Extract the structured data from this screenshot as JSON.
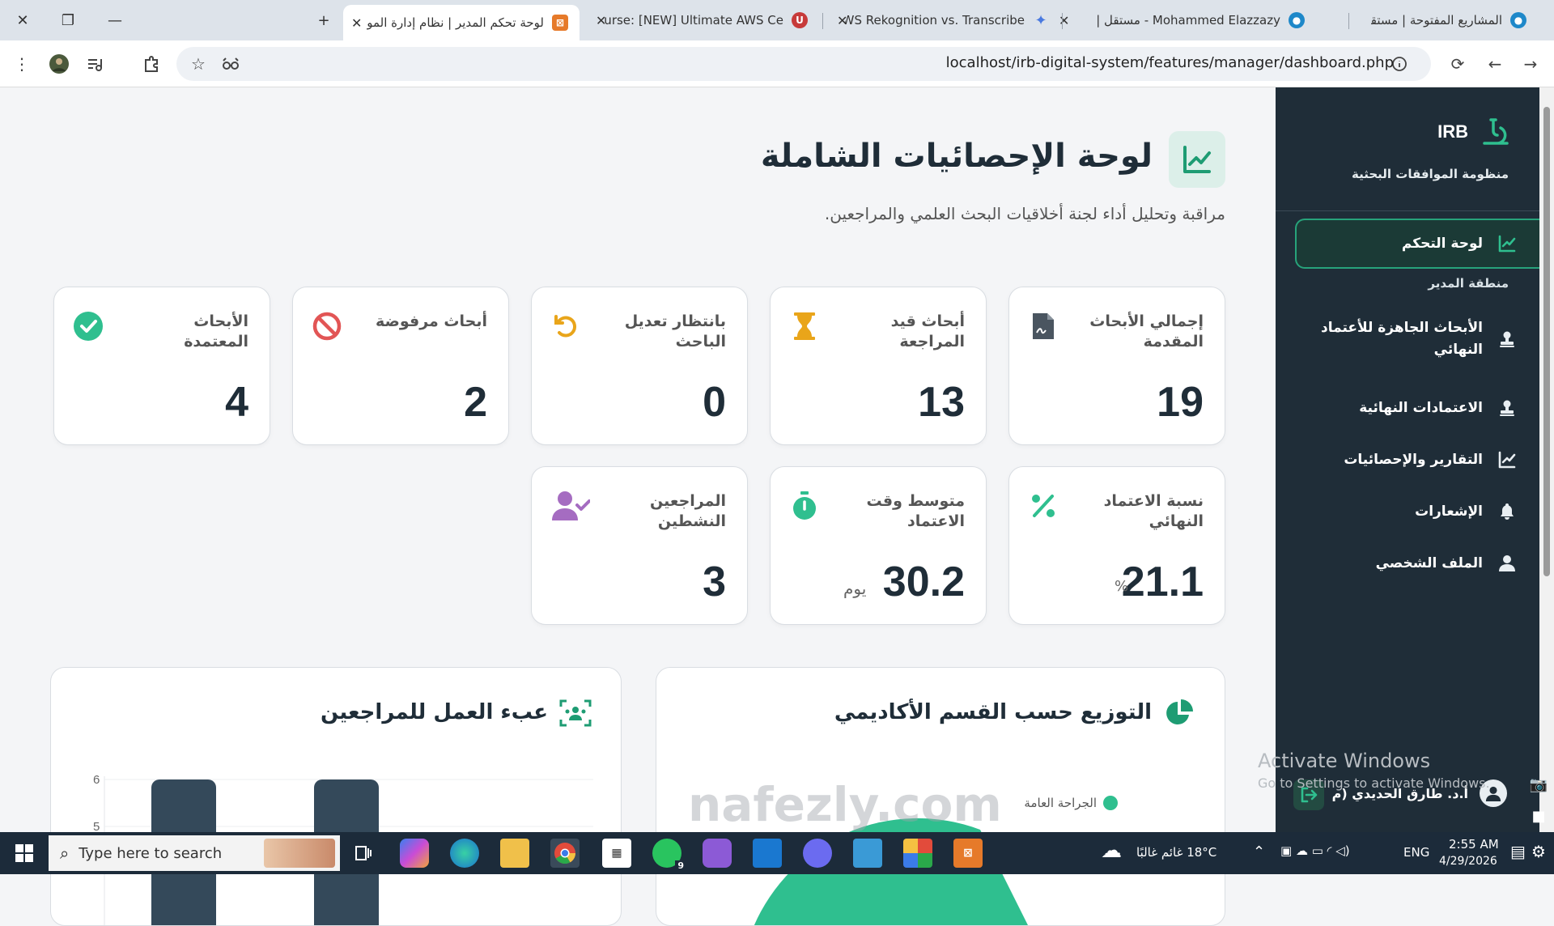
{
  "browser": {
    "tabs": [
      {
        "title": "المشاريع المفتوحة | مستقل",
        "active": false
      },
      {
        "title": "Mohammed Elazzazy - مستقل |",
        "active": false
      },
      {
        "title": "AWS Rekognition vs. Transcribe",
        "active": false
      },
      {
        "title": "Course: [NEW] Ultimate AWS Ce",
        "active": false
      },
      {
        "title": "لوحة تحكم المدير | نظام إدارة المو",
        "active": true
      }
    ],
    "url": "localhost/irb-digital-system/features/manager/dashboard.php"
  },
  "sidebar": {
    "brand": "IRB",
    "subtitle": "منظومة الموافقات البحثية",
    "active_item": "لوحة التحكم",
    "section_label": "منطقة المدير",
    "items": [
      {
        "label": "الأبحاث الجاهزة للأعتماد النهائي",
        "icon": "stamp-icon"
      },
      {
        "label": "الاعتمادات النهائية",
        "icon": "stamp-icon"
      },
      {
        "label": "التقارير والإحصائيات",
        "icon": "chart-line-icon"
      },
      {
        "label": "الإشعارات",
        "icon": "bell-icon"
      },
      {
        "label": "الملف الشخصي",
        "icon": "user-icon"
      }
    ],
    "user_name": "أ.د. طارق الحديدي (م"
  },
  "main": {
    "title": "لوحة الإحصائيات الشاملة",
    "subtitle": "مراقبة وتحليل أداء لجنة أخلاقيات البحث العلمي والمراجعين.",
    "stats": [
      {
        "label": "إجمالي الأبحاث المقدمة",
        "value": "19",
        "icon": "file-signature-icon",
        "color": "#4a5560"
      },
      {
        "label": "أبحاث قيد المراجعة",
        "value": "13",
        "icon": "hourglass-icon",
        "color": "#e9a51a"
      },
      {
        "label": "بانتظار تعديل الباحث",
        "value": "0",
        "icon": "rotate-left-icon",
        "color": "#e9a51a"
      },
      {
        "label": "أبحاث مرفوضة",
        "value": "2",
        "icon": "ban-icon",
        "color": "#e25555"
      },
      {
        "label": "الأبحاث المعتمدة",
        "value": "4",
        "icon": "check-circle-icon",
        "color": "#2fbf8f"
      },
      {
        "label": "نسبة الاعتماد النهائي",
        "value": "21.1",
        "unit": "%",
        "icon": "percent-icon",
        "color": "#2fbf8f"
      },
      {
        "label": "متوسط وقت الاعتماد",
        "value": "30.2",
        "unit": "يوم",
        "icon": "stopwatch-icon",
        "color": "#2fbf8f"
      },
      {
        "label": "المراجعين النشطين",
        "value": "3",
        "icon": "user-check-icon",
        "color": "#a56cc1"
      }
    ],
    "dept_panel": {
      "title": "التوزيع حسب القسم الأكاديمي",
      "legend": [
        "الجراحة العامة"
      ]
    },
    "workload_panel": {
      "title": "عبء العمل للمراجعين"
    }
  },
  "chart_data": {
    "type": "bar",
    "title": "عبء العمل للمراجعين",
    "ylim": [
      0,
      6
    ],
    "y_ticks": [
      "6",
      "5"
    ],
    "values": [
      6,
      6
    ],
    "grid": true
  },
  "overlay": {
    "activate_1": "Activate Windows",
    "activate_2": "Go to Settings to activate Windows.",
    "watermark": "nafezly.com"
  },
  "taskbar": {
    "search_placeholder": "Type here to search",
    "weather": "18°C  غائم غالبًا",
    "lang": "ENG",
    "time": "2:55 AM",
    "date": "4/29/2026",
    "whatsapp_badge": "9"
  }
}
